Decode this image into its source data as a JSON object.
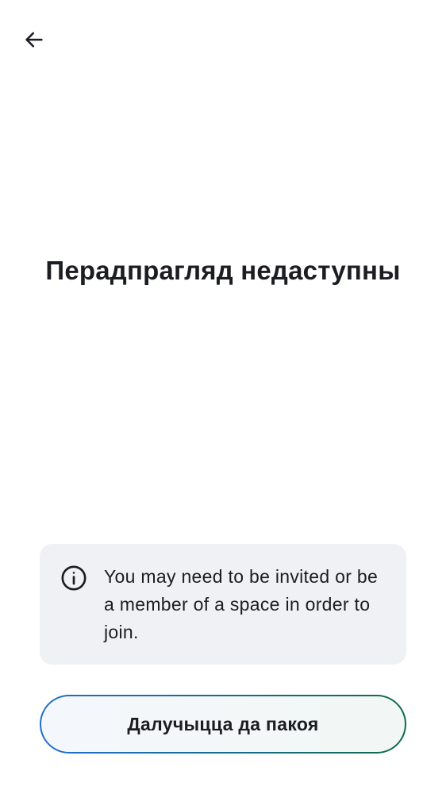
{
  "header": {
    "back_icon": "arrow-left-icon"
  },
  "main": {
    "title": "Перадпрагляд недаступны"
  },
  "notice": {
    "icon": "info-icon",
    "text": "You may need to be invited or be a member of a space in order to join."
  },
  "actions": {
    "join_label": "Далучыцца да пакоя"
  },
  "colors": {
    "text": "#1b1d22",
    "notice_bg": "#f0f1f4",
    "button_border_start": "#1e6fd0",
    "button_border_end": "#0f6a4a"
  }
}
